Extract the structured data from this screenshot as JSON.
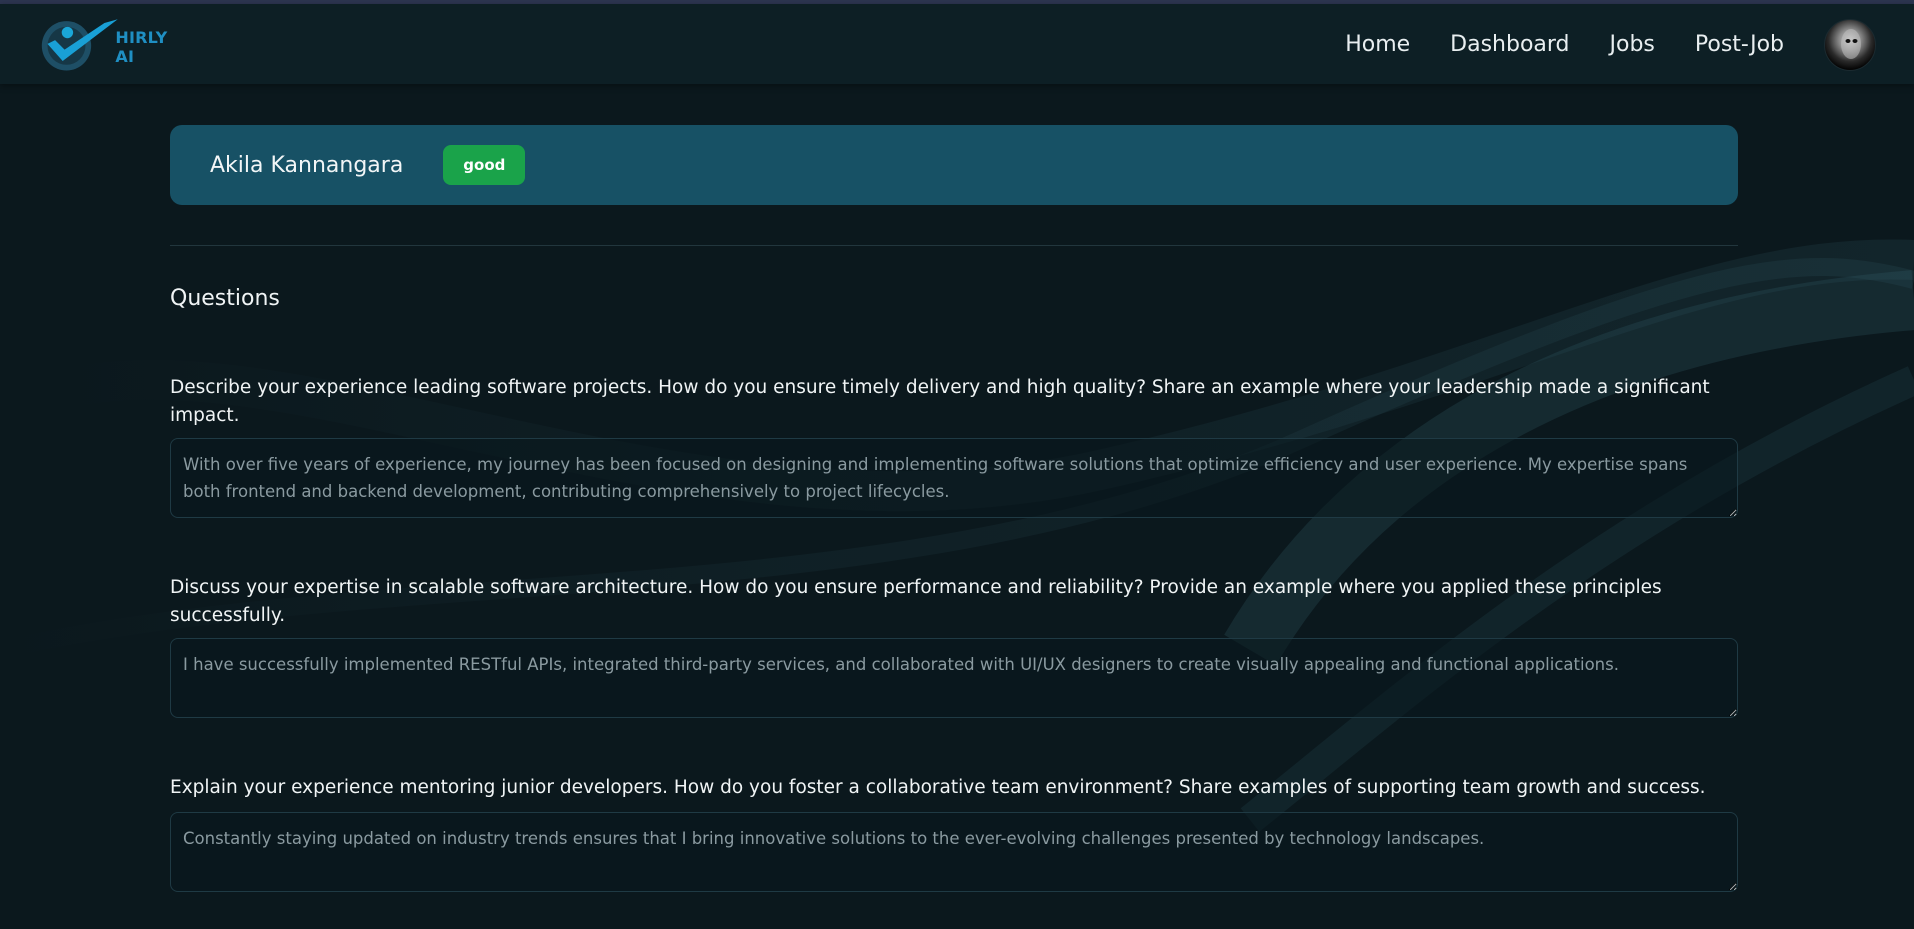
{
  "app": {
    "brand": "HIRLY AI"
  },
  "nav": {
    "items": [
      "Home",
      "Dashboard",
      "Jobs",
      "Post-Job"
    ]
  },
  "candidate": {
    "name": "Akila Kannangara",
    "status": "good"
  },
  "questions_section": {
    "title": "Questions",
    "items": [
      {
        "question": "Describe your experience leading software projects. How do you ensure timely delivery and high quality? Share an example where your leadership made a significant impact.",
        "answer": "With over five years of experience, my journey has been focused on designing and implementing software solutions that optimize efficiency and user experience. My expertise spans both frontend and backend development, contributing comprehensively to project lifecycles."
      },
      {
        "question": "Discuss your expertise in scalable software architecture. How do you ensure performance and reliability? Provide an example where you applied these principles successfully.",
        "answer": "I have successfully implemented RESTful APIs, integrated third-party services, and collaborated with UI/UX designers to create visually appealing and functional applications."
      },
      {
        "question": "Explain your experience mentoring junior developers. How do you foster a collaborative team environment? Share examples of supporting team growth and success.",
        "answer": "Constantly staying updated on industry trends ensures that I bring innovative solutions to the ever-evolving challenges presented by technology landscapes."
      }
    ]
  },
  "colors": {
    "background": "#0b181d",
    "navbar": "#0d1f25",
    "candidate_card": "#175165",
    "status_good": "#1aa34a",
    "brand": "#1f8fc3"
  }
}
